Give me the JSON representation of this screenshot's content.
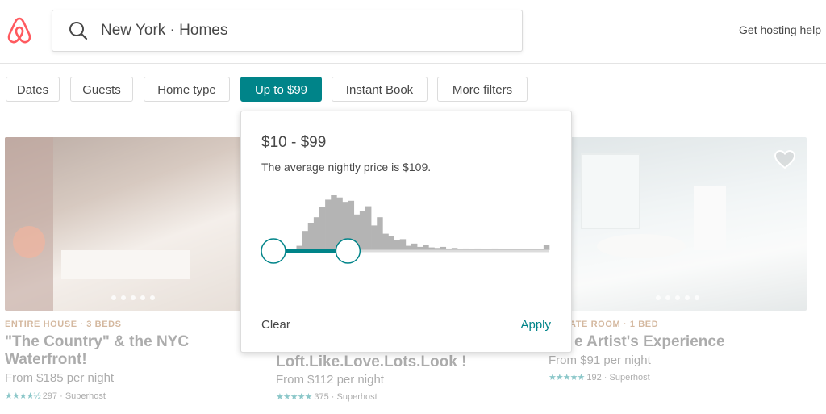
{
  "header": {
    "logo": "airbnb-logo",
    "search_text": "New York · Homes",
    "host_link": "Get hosting help"
  },
  "filters": [
    {
      "label": "Dates",
      "active": false
    },
    {
      "label": "Guests",
      "active": false
    },
    {
      "label": "Home type",
      "active": false
    },
    {
      "label": "Up to $99",
      "active": true
    },
    {
      "label": "Instant Book",
      "active": false
    },
    {
      "label": "More filters",
      "active": false
    }
  ],
  "price_popup": {
    "range_label": "$10 - $99",
    "average_text": "The average nightly price is $109.",
    "histogram_levels": [
      0,
      0,
      0,
      0,
      0.08,
      0.35,
      0.5,
      0.6,
      0.78,
      0.92,
      1.0,
      0.96,
      0.88,
      0.9,
      0.65,
      0.72,
      0.8,
      0.45,
      0.6,
      0.3,
      0.25,
      0.18,
      0.2,
      0.08,
      0.12,
      0.06,
      0.1,
      0.05,
      0.04,
      0.06,
      0.03,
      0.04,
      0.02,
      0.03,
      0.02,
      0.03,
      0.02,
      0.02,
      0.03,
      0.02,
      0.02,
      0.02,
      0.02,
      0.02,
      0.02,
      0.02,
      0.02,
      0.1
    ],
    "slider_min_fraction": 0.0,
    "slider_max_fraction": 0.27,
    "clear_label": "Clear",
    "apply_label": "Apply"
  },
  "listings": [
    {
      "type": "ENTIRE HOUSE · 3 BEDS",
      "title": "\"The Country\" & the NYC Waterfront!",
      "price": "From $185 per night",
      "stars": "★★★★½",
      "reviews": "297 · Superhost"
    },
    {
      "type": "",
      "title": "Loft.Like.Love.Lots.Look !",
      "price": "From $112 per night",
      "stars": "★★★★★",
      "reviews": "375 · Superhost"
    },
    {
      "type": "ATE ROOM · 1 BED",
      "title": "e Artist's Experience",
      "price": "From $91 per night",
      "stars": "★★★★★",
      "reviews": "192 · Superhost"
    }
  ],
  "colors": {
    "accent": "#008489",
    "brand": "#FF5A5F"
  }
}
